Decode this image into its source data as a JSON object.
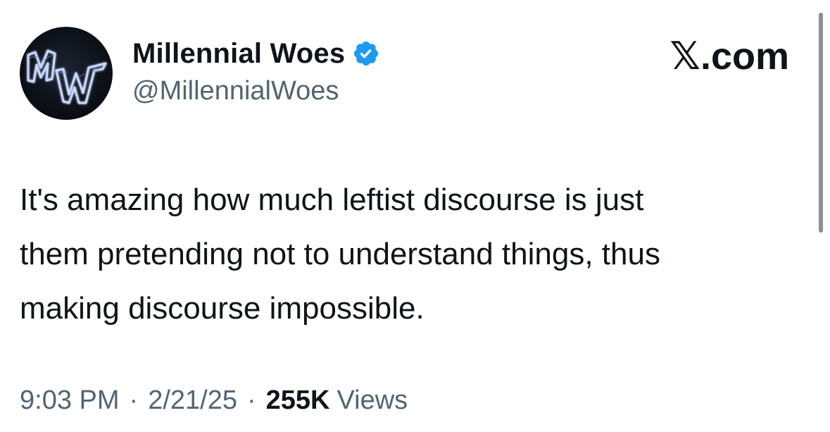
{
  "author": {
    "display_name": "Millennial Woes",
    "handle": "@MillennialWoes",
    "avatar_monogram": "MW",
    "verified": true,
    "verified_badge_color": "#1d9bf0"
  },
  "brand": {
    "label": "𝕏.com"
  },
  "tweet": {
    "text": "It's amazing how much leftist discourse is just\nthem pretending not to understand things, thus\nmaking discourse impossible.",
    "time": "9:03 PM",
    "date": "2/21/25",
    "separator": "·",
    "views_count": "255K",
    "views_label": "Views"
  },
  "colors": {
    "text_primary": "#0f1419",
    "text_secondary": "#536471",
    "background": "#ffffff"
  }
}
